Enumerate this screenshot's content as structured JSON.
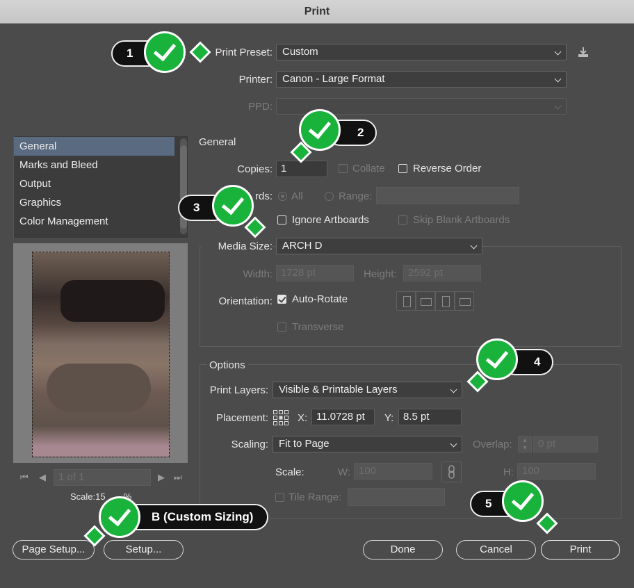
{
  "window": {
    "title": "Print"
  },
  "header": {
    "preset_label": "Print Preset:",
    "preset_value": "Custom",
    "printer_label": "Printer:",
    "printer_value": "Canon - Large Format",
    "ppd_label": "PPD:"
  },
  "sidebar": {
    "items": [
      "General",
      "Marks and Bleed",
      "Output",
      "Graphics",
      "Color Management"
    ],
    "active": 0
  },
  "preview": {
    "page_field": "1 of 1",
    "scale_label": "Scale:15",
    "scale_tail": "%"
  },
  "general": {
    "section_label": "General",
    "copies_label": "Copies:",
    "copies_value": "1",
    "collate_label": "Collate",
    "reverse_label": "Reverse Order",
    "artboards_label": "rds:",
    "all_label": "All",
    "range_label": "Range:",
    "ignore_label": "Ignore Artboards",
    "skip_label": "Skip Blank Artboards",
    "media_label": "Media Size:",
    "media_value": "ARCH D",
    "width_label": "Width:",
    "width_value": "1728 pt",
    "height_label": "Height:",
    "height_value": "2592 pt",
    "orientation_label": "Orientation:",
    "autorotate_label": "Auto-Rotate",
    "transverse_label": "Transverse"
  },
  "options": {
    "section_label": "Options",
    "layers_label": "Print Layers:",
    "layers_value": "Visible & Printable Layers",
    "placement_label": "Placement:",
    "x_label": "X:",
    "x_value": "11.0728 pt",
    "y_label": "Y:",
    "y_value": "8.5 pt",
    "scaling_label": "Scaling:",
    "scaling_value": "Fit to Page",
    "overlap_label": "Overlap:",
    "overlap_value": "0 pt",
    "scale_label": "Scale:",
    "w_label": "W:",
    "w_value": "100",
    "h_label": "H:",
    "h_value": "100",
    "tile_label": "Tile Range:"
  },
  "buttons": {
    "page_setup": "Page Setup...",
    "setup": "Setup...",
    "done": "Done",
    "cancel": "Cancel",
    "print": "Print"
  },
  "annotations": {
    "b1": "1",
    "b2": "2",
    "b3": "3",
    "b4": "4",
    "b5": "5",
    "bb": "B (Custom Sizing)"
  },
  "colors": {
    "badge_green": "#19b33c",
    "badge_black": "#111111",
    "dialog_bg": "#4b4b4b",
    "list_highlight": "#5a6a80"
  }
}
